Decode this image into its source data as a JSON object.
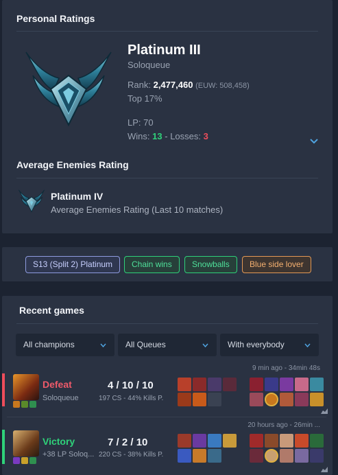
{
  "ratings": {
    "section_title": "Personal Ratings",
    "tier": "Platinum III",
    "queue": "Soloqueue",
    "rank_label": "Rank:",
    "rank_value": "2,477,460",
    "rank_region": "(EUW: 508,458)",
    "top_percent": "Top 17%",
    "lp": "LP: 70",
    "wins_label": "Wins:",
    "wins": "13",
    "separator": "-",
    "losses_label": "Losses:",
    "losses": "3",
    "emblem_icon": "platinum-emblem-icon",
    "expand_icon": "chevron-down-icon"
  },
  "enemies": {
    "section_title": "Average Enemies Rating",
    "tier": "Platinum IV",
    "description": "Average Enemies Rating (Last 10 matches)"
  },
  "tags": [
    {
      "label": "S13 (Split 2) Platinum",
      "color": "#a9b6ff"
    },
    {
      "label": "Chain wins",
      "color": "#2fd27a"
    },
    {
      "label": "Snowballs",
      "color": "#2fd27a"
    },
    {
      "label": "Blue side lover",
      "color": "#f0a35c"
    }
  ],
  "recent": {
    "section_title": "Recent games",
    "filters": [
      {
        "label": "All champions"
      },
      {
        "label": "All Queues"
      },
      {
        "label": "With everybody"
      }
    ]
  },
  "games": [
    {
      "result": "Defeat",
      "result_color": "#ef5a6a",
      "queue": "Soloqueue",
      "kda": "4 / 10 / 10",
      "cs": "197 CS - 44% Kills P.",
      "meta": "9 min ago - 34min 48s"
    },
    {
      "result": "Victory",
      "result_color": "#2fd27a",
      "queue": "+38 LP Soloq...",
      "kda": "7 / 2 / 10",
      "cs": "220 CS - 38% Kills P.",
      "meta": "20 hours ago - 26min ..."
    }
  ],
  "colors": {
    "background": "#1c2331",
    "panel": "#2a3242",
    "accent_blue": "#4fa3e0",
    "win": "#2fd27a",
    "loss": "#ef4d5b"
  }
}
